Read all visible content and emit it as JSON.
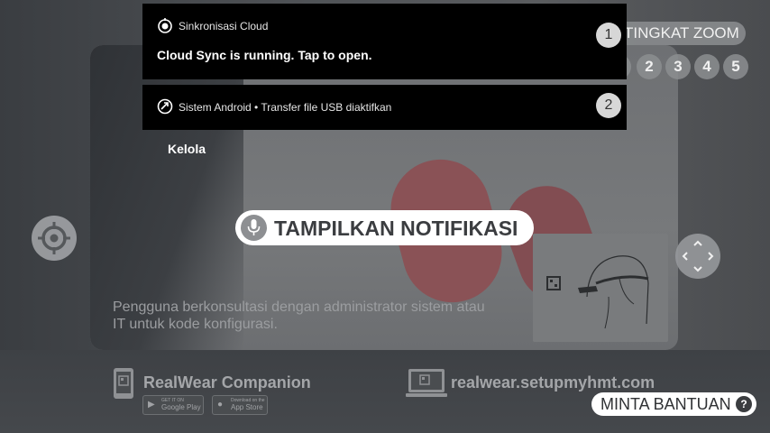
{
  "background": {
    "hint_text": "Pengguna berkonsultasi dengan administrator sistem atau IT untuk kode konfigurasi.",
    "companion": {
      "title": "RealWear Companion",
      "google_play_sub": "GET IT ON",
      "google_play": "Google Play",
      "app_store_sub": "Download on the",
      "app_store": "App Store"
    },
    "web_url": "realwear.setupmyhmt.com"
  },
  "zoom": {
    "label": "TINGKAT ZOOM",
    "levels": [
      "1",
      "2",
      "3",
      "4",
      "5"
    ]
  },
  "voice_command": {
    "label": "TAMPILKAN NOTIFIKASI"
  },
  "help": {
    "label": "MINTA BANTUAN",
    "icon_text": "?"
  },
  "notifications": [
    {
      "app": "Sinkronisasi Cloud",
      "body": "Cloud Sync is running. Tap to open.",
      "number": "1",
      "icon": "cloud-sync-icon"
    },
    {
      "app": "Sistem Android • Transfer file USB diaktifkan",
      "number": "2",
      "icon": "android-system-icon"
    }
  ],
  "manage_label": "Kelola"
}
